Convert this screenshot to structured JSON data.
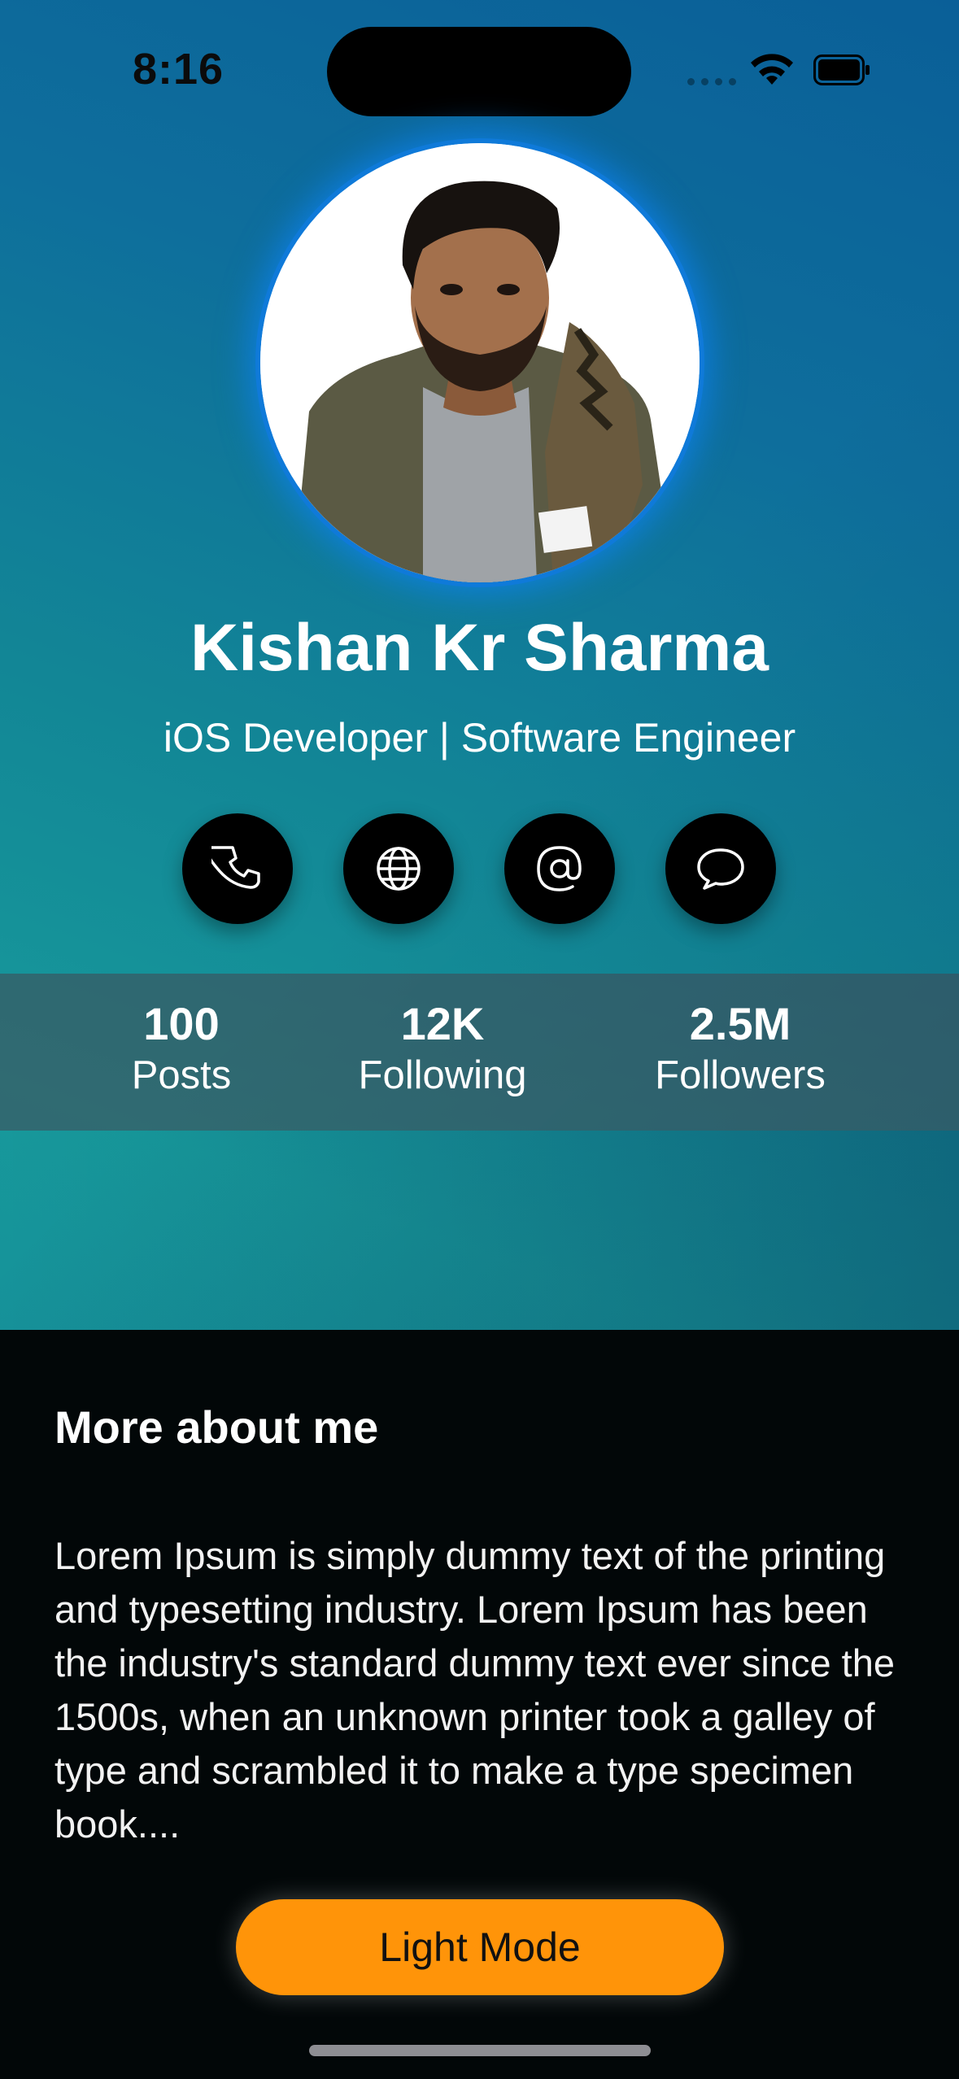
{
  "status_bar": {
    "time": "8:16"
  },
  "profile": {
    "name": "Kishan Kr Sharma",
    "title": "iOS Developer | Software Engineer",
    "avatar_icon": "profile-photo"
  },
  "actions": [
    {
      "name": "phone-icon"
    },
    {
      "name": "globe-icon"
    },
    {
      "name": "at-icon"
    },
    {
      "name": "message-icon"
    }
  ],
  "stats": [
    {
      "value": "100",
      "label": "Posts"
    },
    {
      "value": "12K",
      "label": "Following"
    },
    {
      "value": "2.5M",
      "label": "Followers"
    }
  ],
  "about": {
    "heading": "More about me",
    "body": "Lorem Ipsum is simply dummy text of the printing and typesetting industry. Lorem Ipsum has been the industry's standard dummy text ever since the 1500s, when an unknown printer took a galley of type and scrambled it to make a type specimen book...."
  },
  "mode_button": {
    "label": "Light Mode",
    "color": "#ff9409"
  },
  "colors": {
    "accent": "#0f7ad9",
    "hero_top": "#0a5f98",
    "hero_bottom": "#17999b"
  }
}
